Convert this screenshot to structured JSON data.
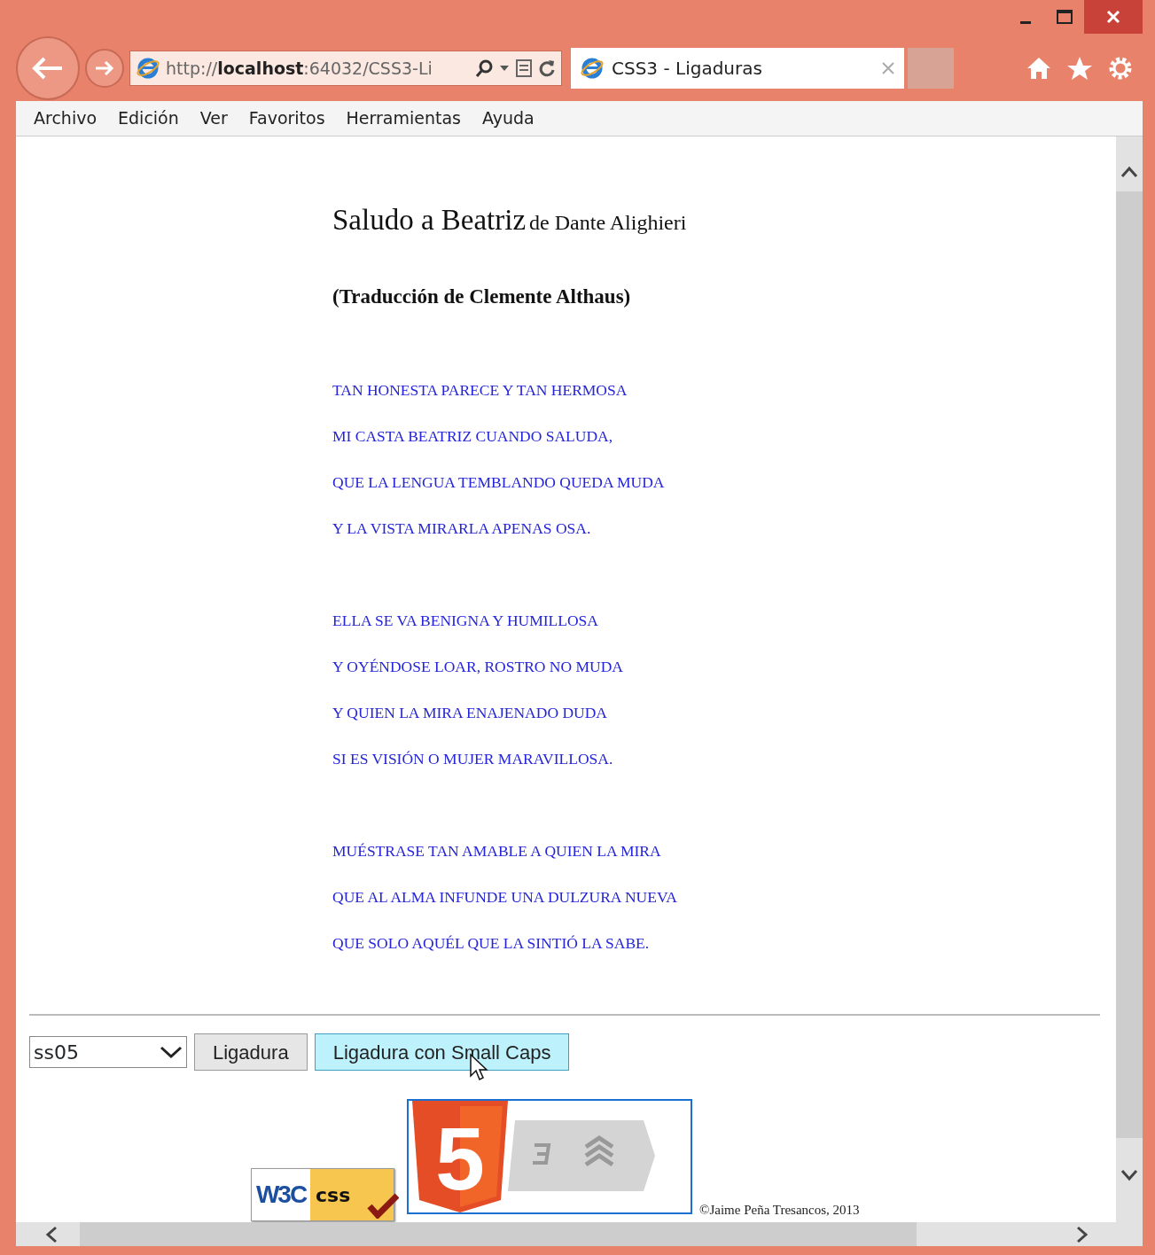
{
  "window": {
    "address": "http://**localhost**:64032/CSS3-Li",
    "tabs": [
      {
        "label": "CSS3 - Ligaduras",
        "selected": true
      },
      {
        "selected": false
      }
    ]
  },
  "menu": [
    "Archivo",
    "Edición",
    "Ver",
    "Favoritos",
    "Herramientas",
    "Ayuda"
  ],
  "page": {
    "title": "Saludo a Beatriz",
    "author": "de Dante Alighieri",
    "subtitle": "(Traducción de Clemente Althaus)",
    "stanzas": [
      [
        "TAN HONESTA PARECE Y TAN HERMOSA",
        "MI CASTA BEATRIZ CUANDO SALUDA,",
        "QUE LA LENGUA TEMBLANDO QUEDA MUDA",
        "Y LA VISTA MIRARLA APENAS OSA."
      ],
      [
        "ELLA SE VA BENIGNA Y HUMILLOSA",
        "Y OYÉNDOSE LOAR, ROSTRO NO MUDA",
        "Y QUIEN LA MIRA ENAJENADO DUDA",
        "SI ES VISIÓN O MUJER MARAVILLOSA."
      ],
      [
        "MUÉSTRASE TAN AMABLE A QUIEN LA MIRA",
        "QUE AL ALMA INFUNDE UNA DULZURA NUEVA",
        "QUE SOLO AQUÉL QUE LA SINTIÓ LA SABE."
      ]
    ],
    "select": "ss05",
    "buttons": [
      {
        "label": "Ligadura",
        "hovered": false
      },
      {
        "label": "Ligadura con Small Caps",
        "hovered": true
      }
    ],
    "w3c_badge": {
      "left": "W3C",
      "right": "css"
    },
    "html5_badge": "5",
    "copyright": "©Jaime Peña Tresancos, 2013"
  }
}
